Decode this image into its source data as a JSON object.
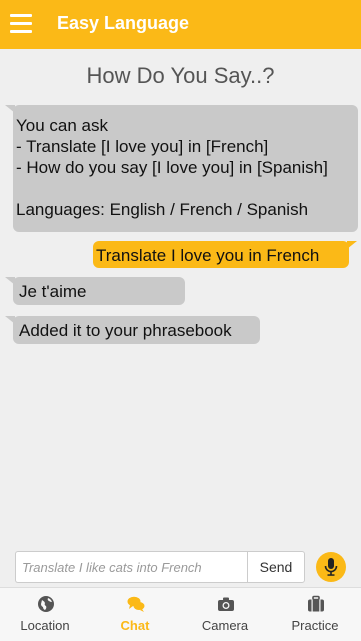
{
  "colors": {
    "accent": "#fbb917",
    "bot_bubble": "#c9c9c9",
    "background": "#efefef"
  },
  "header": {
    "title": "Easy Language",
    "menu_icon": "hamburger-icon"
  },
  "page": {
    "title": "How Do You Say..?"
  },
  "messages": [
    {
      "from": "bot",
      "text": "You can ask\n- Translate [I love you] in [French]\n- How do you say [I love you] in [Spanish]\n\nLanguages: English / French / Spanish"
    },
    {
      "from": "user",
      "text": "Translate I love you in French"
    },
    {
      "from": "bot",
      "text": "Je t'aime"
    },
    {
      "from": "bot",
      "text": "Added it to your phrasebook"
    }
  ],
  "composer": {
    "placeholder": "Translate I like cats into French",
    "value": "",
    "send_label": "Send",
    "mic_icon": "microphone-icon"
  },
  "nav": [
    {
      "label": "Location",
      "icon": "globe-icon",
      "active": false
    },
    {
      "label": "Chat",
      "icon": "chat-bubbles-icon",
      "active": true
    },
    {
      "label": "Camera",
      "icon": "camera-icon",
      "active": false
    },
    {
      "label": "Practice",
      "icon": "suitcase-icon",
      "active": false
    }
  ]
}
